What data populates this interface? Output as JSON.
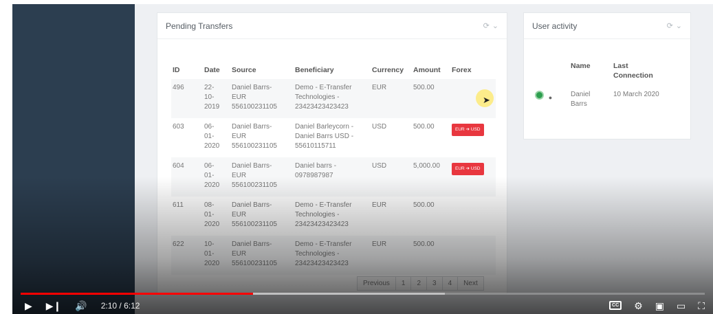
{
  "transfers": {
    "title": "Pending Transfers",
    "columns": [
      "ID",
      "Date",
      "Source",
      "Beneficiary",
      "Currency",
      "Amount",
      "Forex"
    ],
    "rows": [
      {
        "id": "496",
        "date": "22-\n10-\n2019",
        "source": "Daniel Barrs-\nEUR\n556100231105",
        "beneficiary": "Demo - E-Transfer\nTechnologies -\n23423423423423",
        "currency": "EUR",
        "amount": "500.00",
        "forex": ""
      },
      {
        "id": "603",
        "date": "06-\n01-\n2020",
        "source": "Daniel Barrs-\nEUR\n556100231105",
        "beneficiary": "Daniel Barleycorn -\nDaniel Barrs USD -\n55610115711",
        "currency": "USD",
        "amount": "500.00",
        "forex": "EUR ➔ USD"
      },
      {
        "id": "604",
        "date": "06-\n01-\n2020",
        "source": "Daniel Barrs-\nEUR\n556100231105",
        "beneficiary": "Daniel barrs -\n0978987987",
        "currency": "USD",
        "amount": "5,000.00",
        "forex": "EUR ➔ USD"
      },
      {
        "id": "611",
        "date": "08-\n01-\n2020",
        "source": "Daniel Barrs-\nEUR\n556100231105",
        "beneficiary": "Demo - E-Transfer\nTechnologies -\n23423423423423",
        "currency": "EUR",
        "amount": "500.00",
        "forex": ""
      },
      {
        "id": "622",
        "date": "10-\n01-\n2020",
        "source": "Daniel Barrs-\nEUR\n556100231105",
        "beneficiary": "Demo - E-Transfer\nTechnologies -\n23423423423423",
        "currency": "EUR",
        "amount": "500.00",
        "forex": ""
      }
    ],
    "pagination": {
      "previous": "Previous",
      "pages": [
        "1",
        "2",
        "3",
        "4"
      ],
      "next": "Next"
    }
  },
  "activity": {
    "title": "User activity",
    "columns": [
      "Name",
      "Last\nConnection"
    ],
    "rows": [
      {
        "name": "Daniel\nBarrs",
        "last_connection": "10 March 2020"
      }
    ]
  },
  "icons": {
    "refresh": "refresh-icon",
    "collapse": "chevron-down-icon",
    "status": "online-status-icon",
    "user": "user-icon"
  },
  "player": {
    "time": "2:10 / 6:12",
    "played_fraction": 0.34,
    "buffered_fraction": 0.62
  },
  "colors": {
    "sidebar": "#2c3e50",
    "forex_badge": "#e8373f",
    "progress_played": "#ff0000",
    "status_online": "#2e9e4f"
  }
}
